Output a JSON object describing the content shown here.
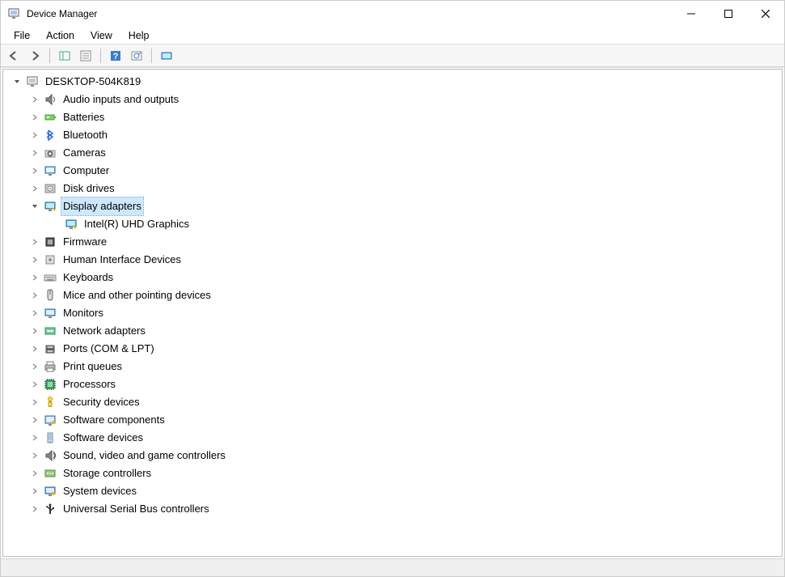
{
  "window": {
    "title": "Device Manager"
  },
  "menu": {
    "items": [
      "File",
      "Action",
      "View",
      "Help"
    ]
  },
  "tree": {
    "root": {
      "label": "DESKTOP-504K819",
      "icon": "computer-icon"
    },
    "categories": [
      {
        "label": "Audio inputs and outputs",
        "icon": "audio-icon",
        "expanded": false,
        "children": []
      },
      {
        "label": "Batteries",
        "icon": "battery-icon",
        "expanded": false,
        "children": []
      },
      {
        "label": "Bluetooth",
        "icon": "bluetooth-icon",
        "expanded": false,
        "children": []
      },
      {
        "label": "Cameras",
        "icon": "camera-icon",
        "expanded": false,
        "children": []
      },
      {
        "label": "Computer",
        "icon": "computer-icon",
        "expanded": false,
        "children": []
      },
      {
        "label": "Disk drives",
        "icon": "disk-icon",
        "expanded": false,
        "children": []
      },
      {
        "label": "Display adapters",
        "icon": "display-icon",
        "expanded": true,
        "selected": true,
        "children": [
          {
            "label": "Intel(R) UHD Graphics",
            "icon": "display-icon"
          }
        ]
      },
      {
        "label": "Firmware",
        "icon": "firmware-icon",
        "expanded": false,
        "children": []
      },
      {
        "label": "Human Interface Devices",
        "icon": "hid-icon",
        "expanded": false,
        "children": []
      },
      {
        "label": "Keyboards",
        "icon": "keyboard-icon",
        "expanded": false,
        "children": []
      },
      {
        "label": "Mice and other pointing devices",
        "icon": "mouse-icon",
        "expanded": false,
        "children": []
      },
      {
        "label": "Monitors",
        "icon": "monitor-icon",
        "expanded": false,
        "children": []
      },
      {
        "label": "Network adapters",
        "icon": "network-icon",
        "expanded": false,
        "children": []
      },
      {
        "label": "Ports (COM & LPT)",
        "icon": "port-icon",
        "expanded": false,
        "children": []
      },
      {
        "label": "Print queues",
        "icon": "printer-icon",
        "expanded": false,
        "children": []
      },
      {
        "label": "Processors",
        "icon": "processor-icon",
        "expanded": false,
        "children": []
      },
      {
        "label": "Security devices",
        "icon": "security-icon",
        "expanded": false,
        "children": []
      },
      {
        "label": "Software components",
        "icon": "software-component-icon",
        "expanded": false,
        "children": []
      },
      {
        "label": "Software devices",
        "icon": "software-device-icon",
        "expanded": false,
        "children": []
      },
      {
        "label": "Sound, video and game controllers",
        "icon": "sound-icon",
        "expanded": false,
        "children": []
      },
      {
        "label": "Storage controllers",
        "icon": "storage-icon",
        "expanded": false,
        "children": []
      },
      {
        "label": "System devices",
        "icon": "system-icon",
        "expanded": false,
        "children": []
      },
      {
        "label": "Universal Serial Bus controllers",
        "icon": "usb-icon",
        "expanded": false,
        "children": []
      }
    ]
  }
}
